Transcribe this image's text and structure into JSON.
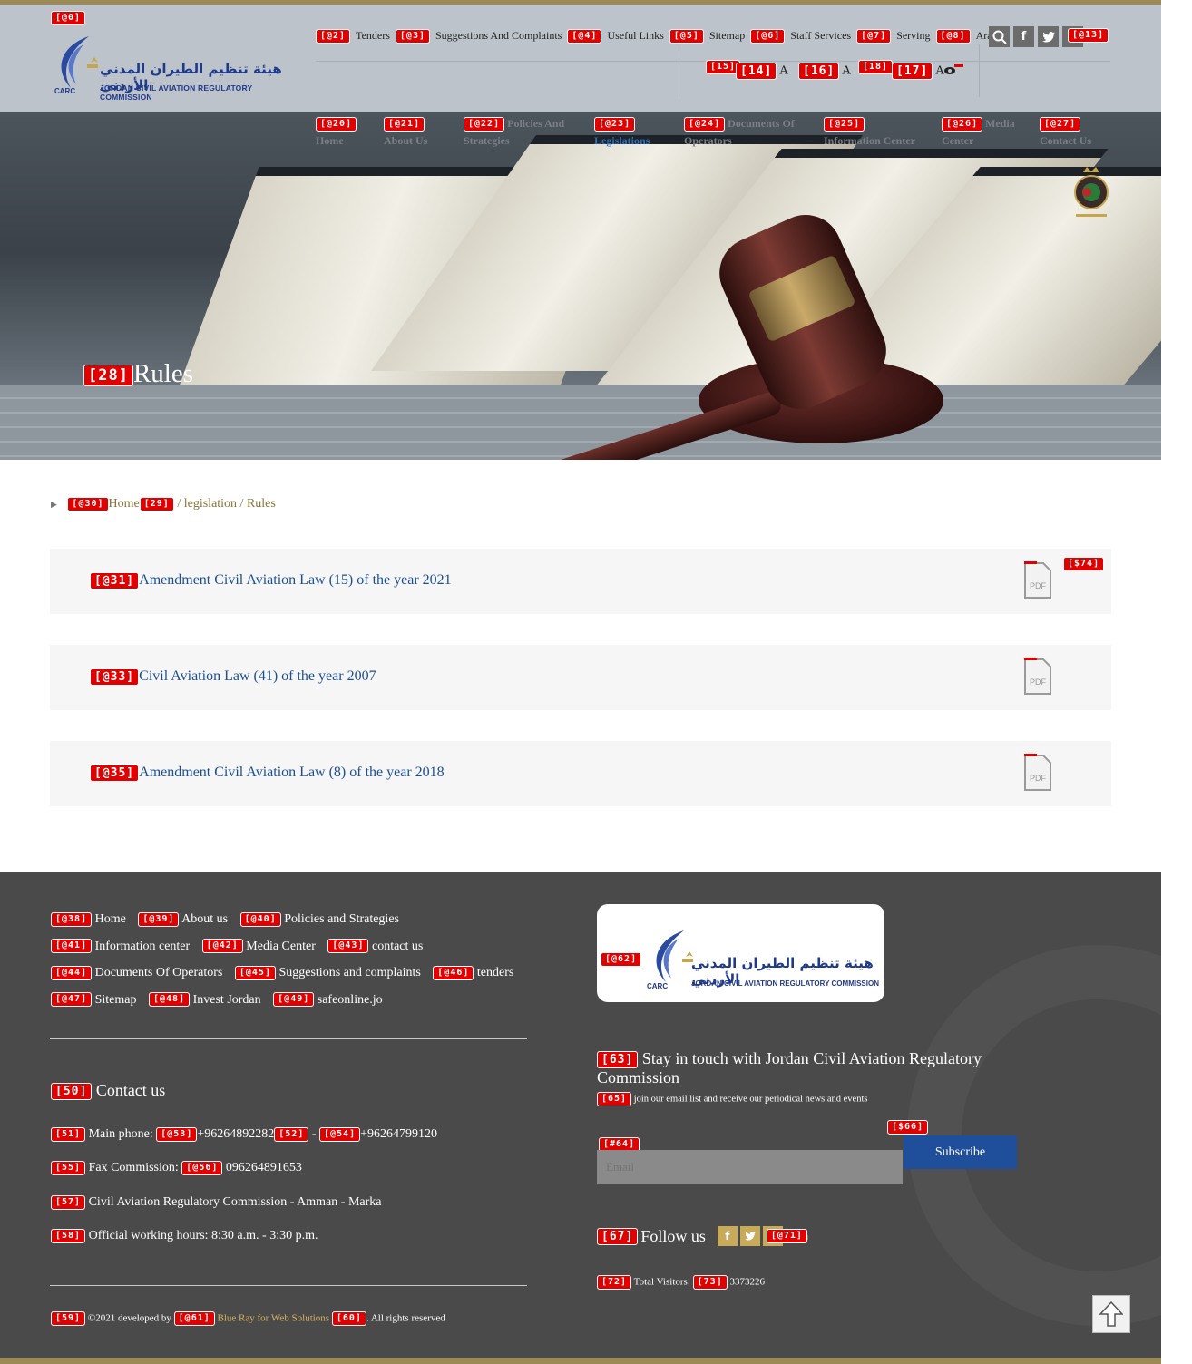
{
  "markers": {
    "m0": "[@0]",
    "m2": "[@2]",
    "m3": "[@3]",
    "m4": "[@4]",
    "m5": "[@5]",
    "m6": "[@6]",
    "m7": "[@7]",
    "m8": "[@8]",
    "m13": "[@13]",
    "m14": "[14]",
    "m15": "[15]",
    "m16": "[16]",
    "m17": "[17]",
    "m18": "[18]",
    "m20": "[@20]",
    "m21": "[@21]",
    "m22": "[@22]",
    "m23": "[@23]",
    "m24": "[@24]",
    "m25": "[@25]",
    "m26": "[@26]",
    "m27": "[@27]",
    "m28": "[28]",
    "m29": "[29]",
    "m30": "[@30]",
    "m31": "[@31]",
    "m33": "[@33]",
    "m35": "[@35]",
    "m38": "[@38]",
    "m39": "[@39]",
    "m40": "[@40]",
    "m41": "[@41]",
    "m42": "[@42]",
    "m43": "[@43]",
    "m44": "[@44]",
    "m45": "[@45]",
    "m46": "[@46]",
    "m47": "[@47]",
    "m48": "[@48]",
    "m49": "[@49]",
    "m50": "[50]",
    "m51": "[51]",
    "m52": "[52]",
    "m53": "[@53]",
    "m54": "[@54]",
    "m55": "[55]",
    "m56": "[@56]",
    "m57": "[57]",
    "m58": "[58]",
    "m59": "[59]",
    "m60": "[60]",
    "m61": "[@61]",
    "m62": "[@62]",
    "m63": "[63]",
    "m64": "[#64]",
    "m65": "[65]",
    "m66": "[$66]",
    "m67": "[67]",
    "m71": "[@71]",
    "m72": "[72]",
    "m73": "[73]",
    "m74": "[$74]"
  },
  "logo": {
    "arabic": "هيئة تنظيم الطيران المدني الأردني",
    "english": "JORDAN CIVIL AVIATION REGULATORY COMMISSION",
    "abbr": "CARC"
  },
  "top_links": {
    "tenders": "Tenders",
    "suggestions": "Suggestions And Complaints",
    "useful_links": "Useful Links",
    "sitemap": "Sitemap",
    "staff_services": "Staff Services",
    "serving": "Serving",
    "arabic": "Arabic"
  },
  "social": {
    "facebook": "f",
    "twitter": "t",
    "linkedin": "in"
  },
  "font_controls": {
    "a_minus": "A",
    "a_normal": "A",
    "a_plus": "A",
    "minus_sign": "-",
    "plus_sign": "+"
  },
  "nav": {
    "home": [
      "Home"
    ],
    "about": [
      "About Us"
    ],
    "policies": [
      "Policies And",
      "Strategies"
    ],
    "legislations": [
      "Legislations"
    ],
    "documents": [
      "Documents Of",
      "Operators"
    ],
    "information": [
      "Information Center"
    ],
    "media": [
      "Media",
      "Center"
    ],
    "contact": [
      "Contact Us"
    ]
  },
  "hero": {
    "title": "Rules"
  },
  "breadcrumb": {
    "home": "Home",
    "rest": " / legislation / Rules"
  },
  "documents": [
    {
      "title": "Amendment Civil Aviation Law (15) of the year 2021"
    },
    {
      "title": "Civil Aviation Law (41) of the year 2007"
    },
    {
      "title": "Amendment Civil Aviation Law (8) of the year 2018"
    }
  ],
  "pdf_label": "PDF",
  "footer": {
    "links": {
      "home": "Home",
      "about": "About us",
      "policies": "Policies and Strategies",
      "information": "Information center",
      "media": "Media Center",
      "contact": "contact us",
      "documents": "Documents Of Operators",
      "suggestions": "Suggestions and complaints",
      "tenders": "tenders",
      "sitemap": "Sitemap",
      "invest": "Invest Jordan",
      "safeonline": "safeonline.jo"
    },
    "contact_heading": "Contact us",
    "main_phone_label": "Main phone:",
    "phone1": "+96264892282",
    "phone_sep": "-",
    "phone2": "+96264799120",
    "fax_label": "Fax Commission:",
    "fax": "096264891653",
    "address": "Civil Aviation Regulatory Commission - Amman - Marka",
    "hours": "Official working hours:  8:30 a.m. - 3:30 p.m.",
    "copyright_prefix": "©2021 developed by",
    "developer": "Blue Ray for Web Solutions",
    "copyright_suffix": ". All rights reserved",
    "stay_heading": "Stay in touch with Jordan Civil Aviation Regulatory Commission",
    "stay_sub": "join our email list and receive our periodical news and events",
    "email_placeholder": "Email",
    "subscribe": "Subscribe",
    "follow_heading": "Follow us",
    "visitors_label": "Total Visitors:",
    "visitors_count": "3373226"
  },
  "colors": {
    "gold": "#9b8a56",
    "header_bg": "#bdc3ca",
    "footer_bg": "#4a4a4a",
    "link_blue": "#1b4f94",
    "subscribe_blue": "#1f4f9a",
    "marker_red": "#e00000"
  }
}
